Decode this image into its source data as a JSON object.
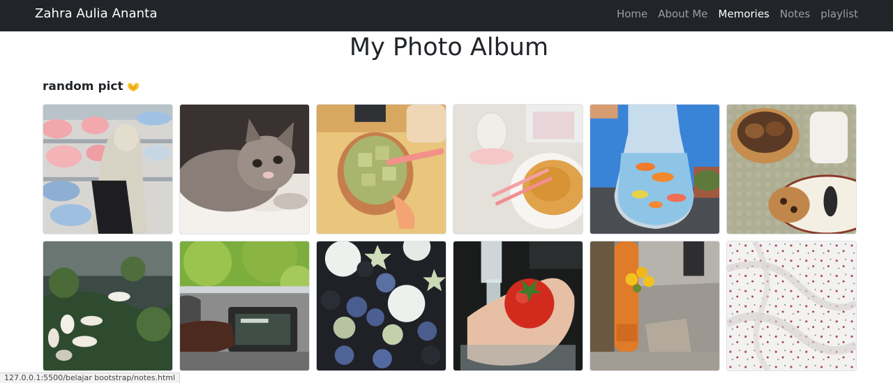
{
  "navbar": {
    "brand": "Zahra Aulia Ananta",
    "links": [
      {
        "label": "Home",
        "active": false
      },
      {
        "label": "About Me",
        "active": false
      },
      {
        "label": "Memories",
        "active": true
      },
      {
        "label": "Notes",
        "active": false
      },
      {
        "label": "playlist",
        "active": false
      }
    ]
  },
  "page": {
    "title": "My Photo Album",
    "section_title": "random pict",
    "section_icon": "heart-hands-emoji"
  },
  "gallery": {
    "photos": [
      {
        "subject": "plush-shop"
      },
      {
        "subject": "kitten"
      },
      {
        "subject": "matcha-drink"
      },
      {
        "subject": "noodles"
      },
      {
        "subject": "goldfish-bag"
      },
      {
        "subject": "cookies"
      },
      {
        "subject": "ducks-pond"
      },
      {
        "subject": "car-dashboard"
      },
      {
        "subject": "berries"
      },
      {
        "subject": "tomato-water"
      },
      {
        "subject": "flowers-street"
      },
      {
        "subject": "floral-sheets"
      }
    ]
  },
  "status_bar": {
    "url": "127.0.0.1:5500/belajar bootstrap/notes.html"
  },
  "colors": {
    "navbar_bg": "#212529",
    "text": "#212529"
  }
}
